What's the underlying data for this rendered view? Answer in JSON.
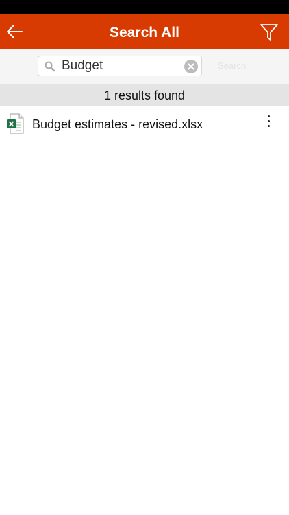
{
  "header": {
    "title": "Search All",
    "back_icon": "arrow-left-icon",
    "filter_icon": "filter-icon",
    "background": "#D83B01"
  },
  "search": {
    "value": "Budget",
    "search_label": "Search",
    "search_icon": "search-icon",
    "clear_icon": "clear-icon"
  },
  "results": {
    "summary": "1 results found",
    "items": [
      {
        "name": "Budget estimates - revised.xlsx",
        "icon": "excel-file-icon",
        "menu_icon": "more-vertical-icon"
      }
    ]
  }
}
